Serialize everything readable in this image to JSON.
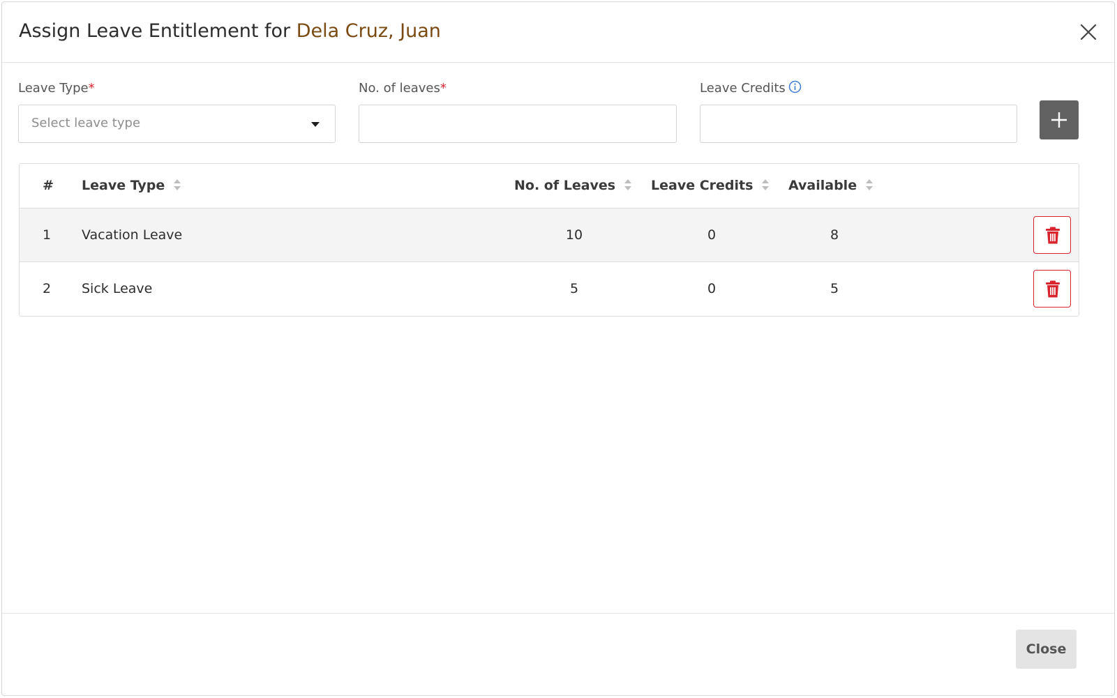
{
  "modal": {
    "title_prefix": "Assign Leave Entitlement for",
    "employee_name": "Dela Cruz, Juan",
    "close_label": "Close"
  },
  "form": {
    "leave_type": {
      "label": "Leave Type",
      "required_mark": "*",
      "placeholder": "Select leave type"
    },
    "no_of_leaves": {
      "label": "No. of leaves",
      "required_mark": "*",
      "value": ""
    },
    "leave_credits": {
      "label": "Leave Credits",
      "value": ""
    }
  },
  "table": {
    "headers": {
      "index": "#",
      "leave_type": "Leave Type",
      "no_of_leaves": "No. of Leaves",
      "leave_credits": "Leave Credits",
      "available": "Available"
    },
    "rows": [
      {
        "index": "1",
        "leave_type": "Vacation Leave",
        "no_of_leaves": "10",
        "leave_credits": "0",
        "available": "8"
      },
      {
        "index": "2",
        "leave_type": "Sick Leave",
        "no_of_leaves": "5",
        "leave_credits": "0",
        "available": "5"
      }
    ]
  },
  "colors": {
    "employee_name": "#7a4a12",
    "required": "#d9232d",
    "add_button": "#626262",
    "delete": "#d9232d",
    "info_icon": "#3a7bd5",
    "row_stripe": "#f4f4f4"
  },
  "icons": {
    "close": "close-icon",
    "dropdown": "chevron-down-icon",
    "info": "info-icon",
    "add": "plus-icon",
    "sort": "sort-icon",
    "delete": "trash-icon"
  }
}
